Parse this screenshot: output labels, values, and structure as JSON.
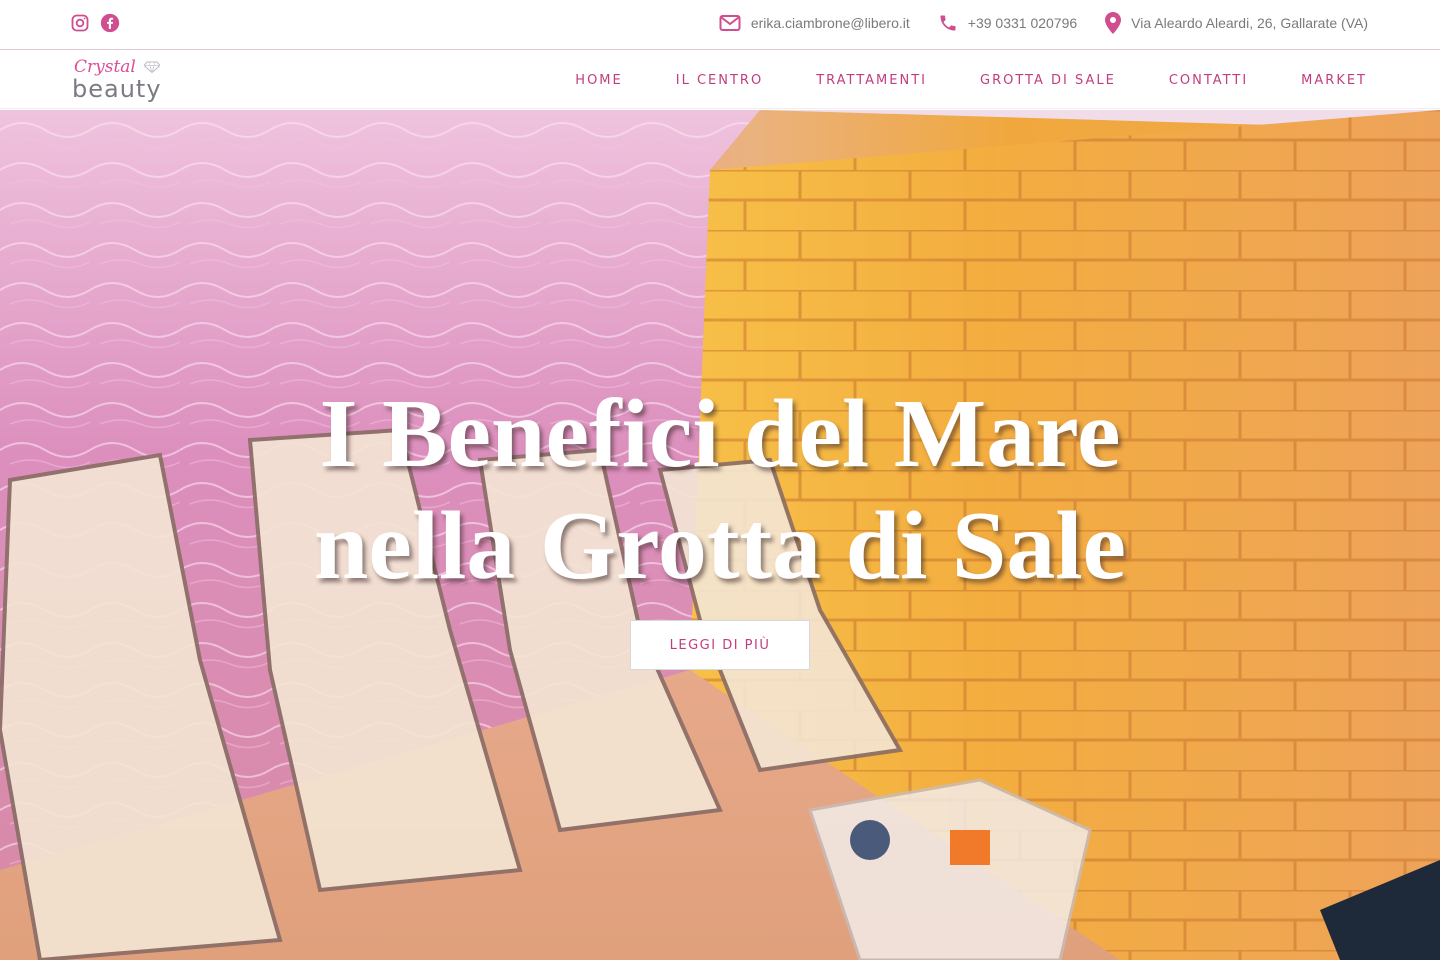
{
  "topbar": {
    "social": [
      {
        "icon": "instagram-icon"
      },
      {
        "icon": "facebook-icon"
      }
    ],
    "email": "erika.ciambrone@libero.it",
    "phone": "+39 0331 020796",
    "address": "Via Aleardo Aleardi, 26, Gallarate (VA)"
  },
  "logo": {
    "script": "Crystal",
    "word": "beauty"
  },
  "nav": {
    "items": [
      {
        "label": "HOME"
      },
      {
        "label": "IL CENTRO"
      },
      {
        "label": "TRATTAMENTI"
      },
      {
        "label": "GROTTA DI SALE"
      },
      {
        "label": "CONTATTI"
      },
      {
        "label": "MARKET"
      }
    ]
  },
  "hero": {
    "title_line1": "I Benefici del Mare",
    "title_line2": "nella Grotta di Sale",
    "cta_label": "LEGGI DI PIÙ"
  },
  "colors": {
    "accent": "#c23d7f",
    "icon": "#d04d8f",
    "text_muted": "#7a7a7a"
  }
}
